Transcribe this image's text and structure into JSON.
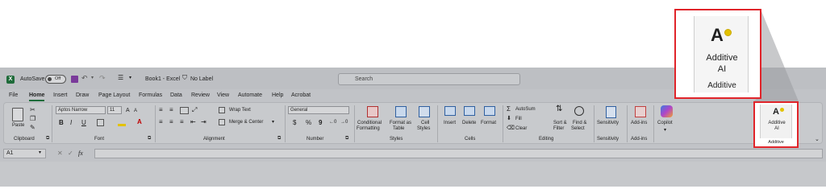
{
  "titlebar": {
    "autosave_label": "AutoSave",
    "autosave_state": "Off",
    "doc_title": "Book1 - Excel",
    "label_status": "No Label",
    "search_placeholder": "Search"
  },
  "tabs": [
    "File",
    "Home",
    "Insert",
    "Draw",
    "Page Layout",
    "Formulas",
    "Data",
    "Review",
    "View",
    "Automate",
    "Help",
    "Acrobat"
  ],
  "active_tab": "Home",
  "ribbon": {
    "clipboard": {
      "label": "Clipboard",
      "paste": "Paste"
    },
    "font": {
      "label": "Font",
      "font_name": "Aptos Narrow",
      "font_size": "11",
      "bold": "B",
      "italic": "I",
      "underline": "U"
    },
    "alignment": {
      "label": "Alignment",
      "wrap_text": "Wrap Text",
      "merge_center": "Merge & Center"
    },
    "number": {
      "label": "Number",
      "format": "General",
      "currency": "$",
      "percent": "%",
      "comma": "9"
    },
    "styles": {
      "label": "Styles",
      "conditional_1": "Conditional",
      "conditional_2": "Formatting",
      "format_table_1": "Format as",
      "format_table_2": "Table",
      "cell_styles_1": "Cell",
      "cell_styles_2": "Styles"
    },
    "cells": {
      "label": "Cells",
      "insert": "Insert",
      "delete": "Delete",
      "format": "Format"
    },
    "editing": {
      "label": "Editing",
      "autosum": "AutoSum",
      "fill": "Fill",
      "clear": "Clear",
      "sort_1": "Sort &",
      "sort_2": "Filter",
      "find_1": "Find &",
      "find_2": "Select"
    },
    "sensitivity": {
      "label": "Sensitivity",
      "button": "Sensitivity"
    },
    "addins": {
      "label": "Add-ins",
      "button": "Add-ins"
    },
    "copilot": {
      "button": "Copilot"
    },
    "additive": {
      "label": "Additive",
      "button_1": "Additive",
      "button_2": "AI"
    }
  },
  "formula_bar": {
    "name_box": "A1",
    "fx": "fx"
  },
  "callout": {
    "button_1": "Additive",
    "button_2": "AI",
    "group": "Additive"
  },
  "colors": {
    "highlight": "#e0242a",
    "excel_green": "#1e6b3a",
    "additive_dot": "#e3c200"
  }
}
